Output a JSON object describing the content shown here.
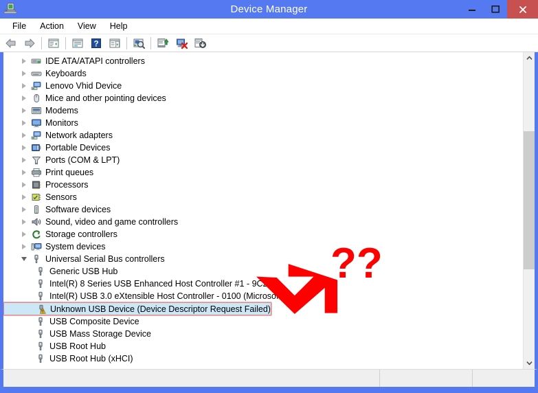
{
  "window": {
    "title": "Device Manager",
    "icon": "device-manager-icon",
    "controls": {
      "minimize": "–",
      "maximize": "❐",
      "close": "✕"
    },
    "colors": {
      "title_bar": "#5579f0",
      "close_button": "#c75050",
      "selection_bg": "#cce8f7",
      "selection_border": "#e08b8b",
      "annotation_red": "#ff0000"
    }
  },
  "menubar": {
    "items": [
      {
        "label": "File",
        "name": "menu-file"
      },
      {
        "label": "Action",
        "name": "menu-action"
      },
      {
        "label": "View",
        "name": "menu-view"
      },
      {
        "label": "Help",
        "name": "menu-help"
      }
    ]
  },
  "toolbar": {
    "buttons": [
      {
        "name": "back-arrow-icon",
        "type": "icon"
      },
      {
        "name": "forward-arrow-icon",
        "type": "icon"
      },
      {
        "name": "separator",
        "type": "sep"
      },
      {
        "name": "show-hide-console-tree-icon",
        "type": "icon"
      },
      {
        "name": "separator",
        "type": "sep"
      },
      {
        "name": "properties-icon",
        "type": "icon"
      },
      {
        "name": "help-icon",
        "type": "icon"
      },
      {
        "name": "show-hide-action-pane-icon",
        "type": "icon"
      },
      {
        "name": "separator",
        "type": "sep"
      },
      {
        "name": "scan-for-hardware-changes-icon",
        "type": "icon"
      },
      {
        "name": "separator",
        "type": "sep"
      },
      {
        "name": "update-driver-software-icon",
        "type": "icon"
      },
      {
        "name": "uninstall-device-icon",
        "type": "icon"
      },
      {
        "name": "disable-enable-device-icon",
        "type": "icon"
      }
    ]
  },
  "tree": {
    "items": [
      {
        "label": "IDE ATA/ATAPI controllers",
        "icon": "ide-controller-icon",
        "depth": 1,
        "state": "collapsed"
      },
      {
        "label": "Keyboards",
        "icon": "keyboard-icon",
        "depth": 1,
        "state": "collapsed"
      },
      {
        "label": "Lenovo Vhid Device",
        "icon": "network-device-icon",
        "depth": 1,
        "state": "collapsed"
      },
      {
        "label": "Mice and other pointing devices",
        "icon": "mouse-icon",
        "depth": 1,
        "state": "collapsed"
      },
      {
        "label": "Modems",
        "icon": "modem-icon",
        "depth": 1,
        "state": "collapsed"
      },
      {
        "label": "Monitors",
        "icon": "monitor-icon",
        "depth": 1,
        "state": "collapsed"
      },
      {
        "label": "Network adapters",
        "icon": "network-adapter-icon",
        "depth": 1,
        "state": "collapsed"
      },
      {
        "label": "Portable Devices",
        "icon": "portable-device-icon",
        "depth": 1,
        "state": "collapsed"
      },
      {
        "label": "Ports (COM & LPT)",
        "icon": "port-icon",
        "depth": 1,
        "state": "collapsed"
      },
      {
        "label": "Print queues",
        "icon": "printer-icon",
        "depth": 1,
        "state": "collapsed"
      },
      {
        "label": "Processors",
        "icon": "processor-icon",
        "depth": 1,
        "state": "collapsed"
      },
      {
        "label": "Sensors",
        "icon": "sensor-icon",
        "depth": 1,
        "state": "collapsed"
      },
      {
        "label": "Software devices",
        "icon": "software-device-icon",
        "depth": 1,
        "state": "collapsed"
      },
      {
        "label": "Sound, video and game controllers",
        "icon": "speaker-icon",
        "depth": 1,
        "state": "collapsed"
      },
      {
        "label": "Storage controllers",
        "icon": "storage-controller-icon",
        "depth": 1,
        "state": "collapsed"
      },
      {
        "label": "System devices",
        "icon": "system-device-icon",
        "depth": 1,
        "state": "collapsed"
      },
      {
        "label": "Universal Serial Bus controllers",
        "icon": "usb-icon",
        "depth": 1,
        "state": "expanded"
      },
      {
        "label": "Generic USB Hub",
        "icon": "usb-icon",
        "depth": 2,
        "state": "leaf"
      },
      {
        "label": "Intel(R) 8 Series USB Enhanced Host Controller #1 - 9C26",
        "icon": "usb-icon",
        "depth": 2,
        "state": "leaf"
      },
      {
        "label": "Intel(R) USB 3.0 eXtensible Host Controller - 0100 (Microsoft)",
        "icon": "usb-icon",
        "depth": 2,
        "state": "leaf"
      },
      {
        "label": "Unknown USB Device (Device Descriptor Request Failed)",
        "icon": "usb-warning-icon",
        "depth": 2,
        "state": "leaf",
        "selected": true,
        "warning": true
      },
      {
        "label": "USB Composite Device",
        "icon": "usb-icon",
        "depth": 2,
        "state": "leaf"
      },
      {
        "label": "USB Mass Storage Device",
        "icon": "usb-icon",
        "depth": 2,
        "state": "leaf"
      },
      {
        "label": "USB Root Hub",
        "icon": "usb-icon",
        "depth": 2,
        "state": "leaf"
      },
      {
        "label": "USB Root Hub (xHCI)",
        "icon": "usb-icon",
        "depth": 2,
        "state": "leaf"
      }
    ]
  },
  "scrollbar": {
    "up_arrow": "▲",
    "down_arrow": "▼",
    "thumb_top_percent": 23,
    "thumb_height_percent": 47
  },
  "statusbar": {
    "panel1": "",
    "panel2": "",
    "panel3": ""
  },
  "annotation": {
    "question_marks": "??",
    "arrow": "red-arrow-pointing-down-left",
    "color": "#ff0000"
  }
}
